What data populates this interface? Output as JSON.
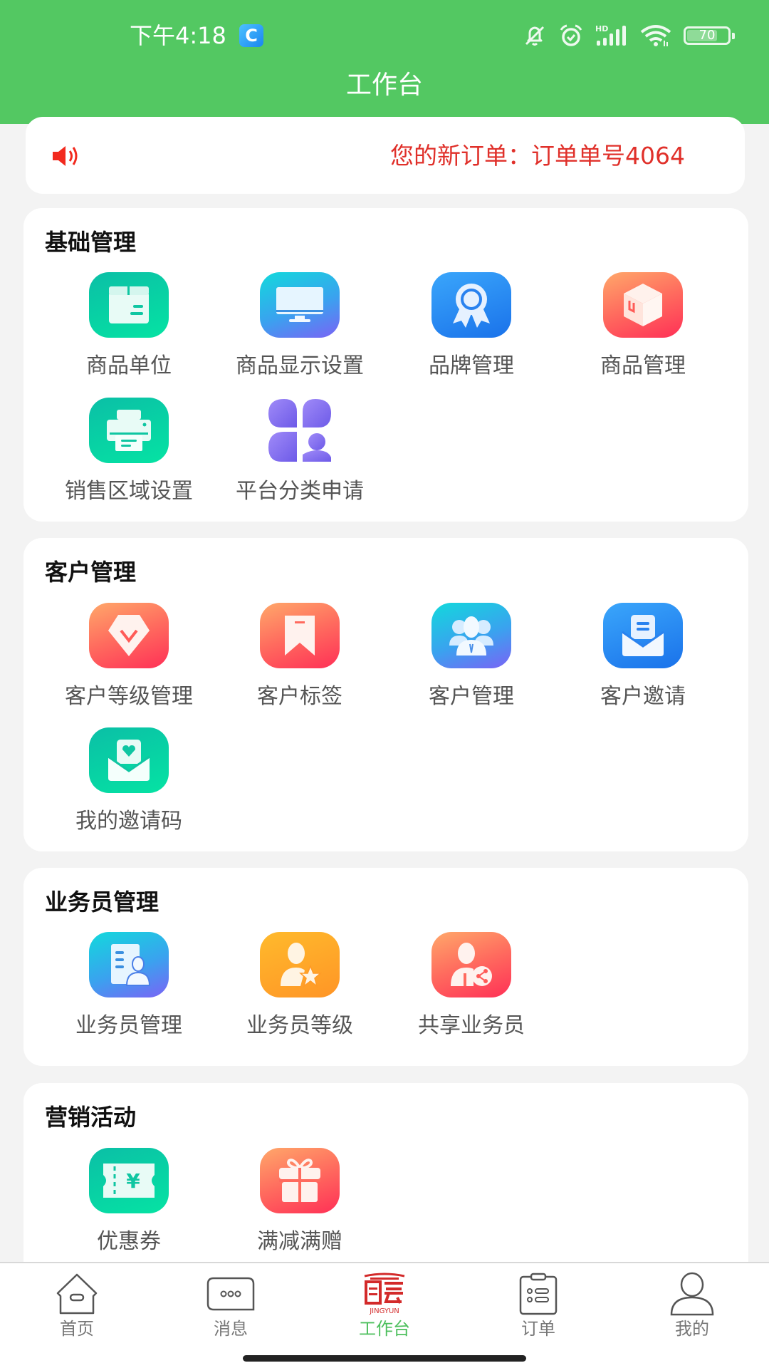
{
  "status_bar": {
    "time": "下午4:18",
    "app_badge": "C",
    "battery_level": "70",
    "icons": [
      "bell-off-icon",
      "alarm-icon",
      "hd-signal-icon",
      "wifi-icon",
      "battery-icon"
    ]
  },
  "header": {
    "title": "工作台"
  },
  "notice": {
    "icon": "speaker-icon",
    "text": "您的新订单：订单单号4064"
  },
  "colors": {
    "header_green": "#53c862",
    "notice_red": "#e0302a",
    "tab_active_green": "#4cbf5c",
    "logo_red": "#d32a2a"
  },
  "sections": [
    {
      "title": "基础管理",
      "items": [
        {
          "label": "商品单位",
          "icon": "package-box-icon"
        },
        {
          "label": "商品显示设置",
          "icon": "monitor-icon"
        },
        {
          "label": "品牌管理",
          "icon": "award-ribbon-icon"
        },
        {
          "label": "商品管理",
          "icon": "cube-icon"
        },
        {
          "label": "销售区域设置",
          "icon": "printer-icon"
        },
        {
          "label": "平台分类申请",
          "icon": "category-apply-icon"
        }
      ]
    },
    {
      "title": "客户管理",
      "items": [
        {
          "label": "客户等级管理",
          "icon": "diamond-grade-icon"
        },
        {
          "label": "客户标签",
          "icon": "bookmark-tag-icon"
        },
        {
          "label": "客户管理",
          "icon": "customer-group-icon"
        },
        {
          "label": "客户邀请",
          "icon": "invite-envelope-icon"
        },
        {
          "label": "我的邀请码",
          "icon": "heart-envelope-icon"
        }
      ]
    },
    {
      "title": "业务员管理",
      "items": [
        {
          "label": "业务员管理",
          "icon": "staff-document-icon"
        },
        {
          "label": "业务员等级",
          "icon": "staff-star-icon"
        },
        {
          "label": "共享业务员",
          "icon": "staff-share-icon"
        }
      ]
    },
    {
      "title": "营销活动",
      "items": [
        {
          "label": "优惠券",
          "icon": "coupon-icon"
        },
        {
          "label": "满减满赠",
          "icon": "gift-icon"
        }
      ]
    }
  ],
  "tabbar": {
    "active": "工作台",
    "logo_text": "JINGYUN",
    "tabs": [
      {
        "label": "首页",
        "icon": "home-icon"
      },
      {
        "label": "消息",
        "icon": "message-icon"
      },
      {
        "label": "工作台",
        "icon": "jingyun-logo-icon"
      },
      {
        "label": "订单",
        "icon": "order-clipboard-icon"
      },
      {
        "label": "我的",
        "icon": "profile-icon"
      }
    ]
  }
}
